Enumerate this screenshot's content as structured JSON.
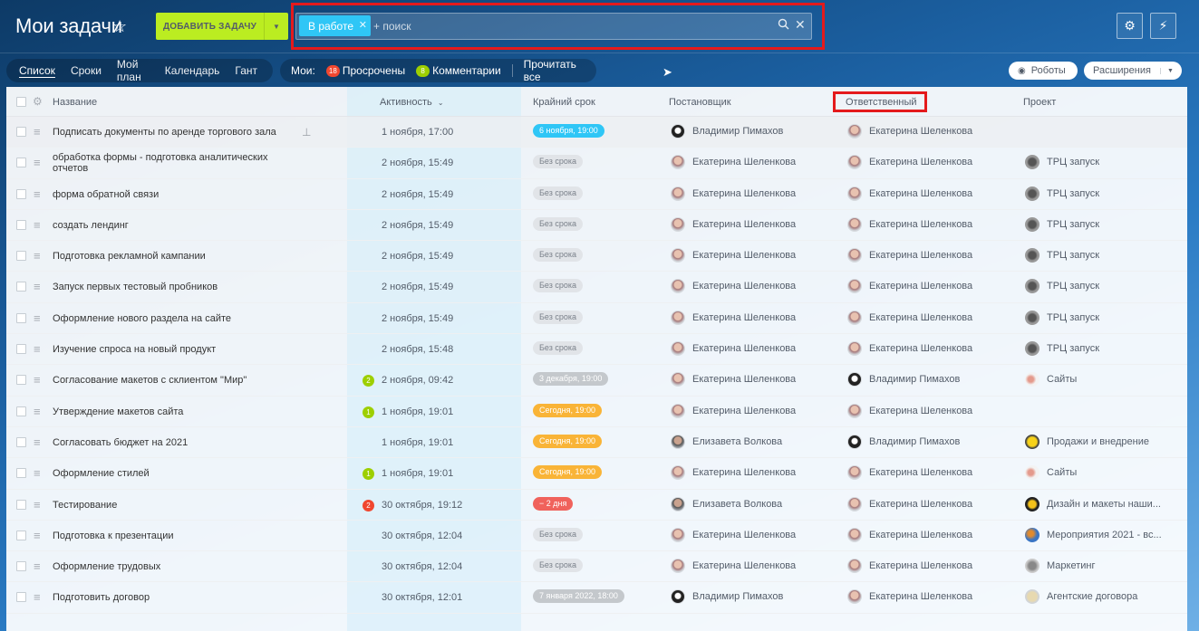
{
  "header": {
    "title": "Мои задачи",
    "add_task_label": "ДОБАВИТЬ ЗАДАЧУ",
    "filter_chip": "В работе",
    "search_placeholder": "+ поиск"
  },
  "view_tabs": [
    "Список",
    "Сроки",
    "Мой план",
    "Календарь",
    "Гант"
  ],
  "counters": {
    "label": "Мои:",
    "overdue_count": "18",
    "overdue_label": "Просрочены",
    "comments_count": "8",
    "comments_label": "Комментарии",
    "read_all": "Прочитать все"
  },
  "right_buttons": {
    "robots": "Роботы",
    "extensions": "Расширения"
  },
  "columns": {
    "name": "Название",
    "activity": "Активность",
    "deadline": "Крайний срок",
    "creator": "Постановщик",
    "responsible": "Ответственный",
    "project": "Проект"
  },
  "colors": {
    "accent_green": "#bbed21",
    "accent_blue": "#2fc6f6",
    "highlight_red": "#e41a1c",
    "deadline_today": "#f9b437",
    "deadline_overdue": "#f0625c"
  },
  "rows": [
    {
      "name": "Подписать документы по аренде торгового зала",
      "pinned": true,
      "count": "",
      "activity": "1 ноября, 17:00",
      "deadline": "6 ноября, 19:00",
      "deadline_kind": "future",
      "creator": "Владимир Пимахов",
      "creator_av": "vp",
      "responsible": "Екатерина Шеленкова",
      "resp_av": "ek",
      "project": "",
      "project_icon": ""
    },
    {
      "name": "обработка формы - подготовка аналитических отчетов",
      "pinned": false,
      "count": "",
      "activity": "2 ноября, 15:49",
      "deadline": "Без срока",
      "deadline_kind": "none",
      "creator": "Екатерина Шеленкова",
      "creator_av": "ek",
      "responsible": "Екатерина Шеленкова",
      "resp_av": "ek",
      "project": "ТРЦ запуск",
      "project_icon": "trc"
    },
    {
      "name": "форма обратной связи",
      "pinned": false,
      "count": "",
      "activity": "2 ноября, 15:49",
      "deadline": "Без срока",
      "deadline_kind": "none",
      "creator": "Екатерина Шеленкова",
      "creator_av": "ek",
      "responsible": "Екатерина Шеленкова",
      "resp_av": "ek",
      "project": "ТРЦ запуск",
      "project_icon": "trc"
    },
    {
      "name": "создать лендинг",
      "pinned": false,
      "count": "",
      "activity": "2 ноября, 15:49",
      "deadline": "Без срока",
      "deadline_kind": "none",
      "creator": "Екатерина Шеленкова",
      "creator_av": "ek",
      "responsible": "Екатерина Шеленкова",
      "resp_av": "ek",
      "project": "ТРЦ запуск",
      "project_icon": "trc"
    },
    {
      "name": "Подготовка рекламной кампании",
      "pinned": false,
      "count": "",
      "activity": "2 ноября, 15:49",
      "deadline": "Без срока",
      "deadline_kind": "none",
      "creator": "Екатерина Шеленкова",
      "creator_av": "ek",
      "responsible": "Екатерина Шеленкова",
      "resp_av": "ek",
      "project": "ТРЦ запуск",
      "project_icon": "trc"
    },
    {
      "name": "Запуск первых тестовый пробников",
      "pinned": false,
      "count": "",
      "activity": "2 ноября, 15:49",
      "deadline": "Без срока",
      "deadline_kind": "none",
      "creator": "Екатерина Шеленкова",
      "creator_av": "ek",
      "responsible": "Екатерина Шеленкова",
      "resp_av": "ek",
      "project": "ТРЦ запуск",
      "project_icon": "trc"
    },
    {
      "name": "Оформление нового раздела на сайте",
      "pinned": false,
      "count": "",
      "activity": "2 ноября, 15:49",
      "deadline": "Без срока",
      "deadline_kind": "none",
      "creator": "Екатерина Шеленкова",
      "creator_av": "ek",
      "responsible": "Екатерина Шеленкова",
      "resp_av": "ek",
      "project": "ТРЦ запуск",
      "project_icon": "trc"
    },
    {
      "name": "Изучение спроса на новый продукт",
      "pinned": false,
      "count": "",
      "activity": "2 ноября, 15:48",
      "deadline": "Без срока",
      "deadline_kind": "none",
      "creator": "Екатерина Шеленкова",
      "creator_av": "ek",
      "responsible": "Екатерина Шеленкова",
      "resp_av": "ek",
      "project": "ТРЦ запуск",
      "project_icon": "trc"
    },
    {
      "name": "Согласование макетов с склиентом \"Мир\"",
      "pinned": false,
      "count": "2",
      "count_color": "#9dcf00",
      "activity": "2 ноября, 09:42",
      "deadline": "3 декабря, 19:00",
      "deadline_kind": "past",
      "creator": "Екатерина Шеленкова",
      "creator_av": "ek",
      "responsible": "Владимир Пимахов",
      "resp_av": "vp",
      "project": "Сайты",
      "project_icon": "sites"
    },
    {
      "name": "Утверждение макетов сайта",
      "pinned": false,
      "count": "1",
      "count_color": "#9dcf00",
      "activity": "1 ноября, 19:01",
      "deadline": "Сегодня, 19:00",
      "deadline_kind": "today",
      "creator": "Екатерина Шеленкова",
      "creator_av": "ek",
      "responsible": "Екатерина Шеленкова",
      "resp_av": "ek",
      "project": "",
      "project_icon": ""
    },
    {
      "name": "Согласовать бюджет на 2021",
      "pinned": false,
      "count": "",
      "activity": "1 ноября, 19:01",
      "deadline": "Сегодня, 19:00",
      "deadline_kind": "today",
      "creator": "Елизавета Волкова",
      "creator_av": "ev",
      "responsible": "Владимир Пимахов",
      "resp_av": "vp",
      "project": "Продажи и внедрение",
      "project_icon": "sales"
    },
    {
      "name": "Оформление стилей",
      "pinned": false,
      "count": "1",
      "count_color": "#9dcf00",
      "activity": "1 ноября, 19:01",
      "deadline": "Сегодня, 19:00",
      "deadline_kind": "today",
      "creator": "Екатерина Шеленкова",
      "creator_av": "ek",
      "responsible": "Екатерина Шеленкова",
      "resp_av": "ek",
      "project": "Сайты",
      "project_icon": "sites"
    },
    {
      "name": "Тестирование",
      "pinned": false,
      "count": "2",
      "count_color": "#f0472f",
      "activity": "30 октября, 19:12",
      "deadline": "− 2 дня",
      "deadline_kind": "overdue",
      "creator": "Елизавета Волкова",
      "creator_av": "ev",
      "responsible": "Екатерина Шеленкова",
      "resp_av": "ek",
      "project": "Дизайн и макеты наши...",
      "project_icon": "design"
    },
    {
      "name": "Подготовка к презентации",
      "pinned": false,
      "count": "",
      "activity": "30 октября, 12:04",
      "deadline": "Без срока",
      "deadline_kind": "none",
      "creator": "Екатерина Шеленкова",
      "creator_av": "ek",
      "responsible": "Екатерина Шеленкова",
      "resp_av": "ek",
      "project": "Мероприятия 2021 - вс...",
      "project_icon": "events"
    },
    {
      "name": "Оформление трудовых",
      "pinned": false,
      "count": "",
      "activity": "30 октября, 12:04",
      "deadline": "Без срока",
      "deadline_kind": "none",
      "creator": "Екатерина Шеленкова",
      "creator_av": "ek",
      "responsible": "Екатерина Шеленкова",
      "resp_av": "ek",
      "project": "Маркетинг",
      "project_icon": "mkt"
    },
    {
      "name": "Подготовить договор",
      "pinned": false,
      "count": "",
      "activity": "30 октября, 12:01",
      "deadline": "7 января 2022, 18:00",
      "deadline_kind": "past",
      "creator": "Владимир Пимахов",
      "creator_av": "vp",
      "responsible": "Екатерина Шеленкова",
      "resp_av": "ek",
      "project": "Агентские договора",
      "project_icon": "agency"
    }
  ]
}
